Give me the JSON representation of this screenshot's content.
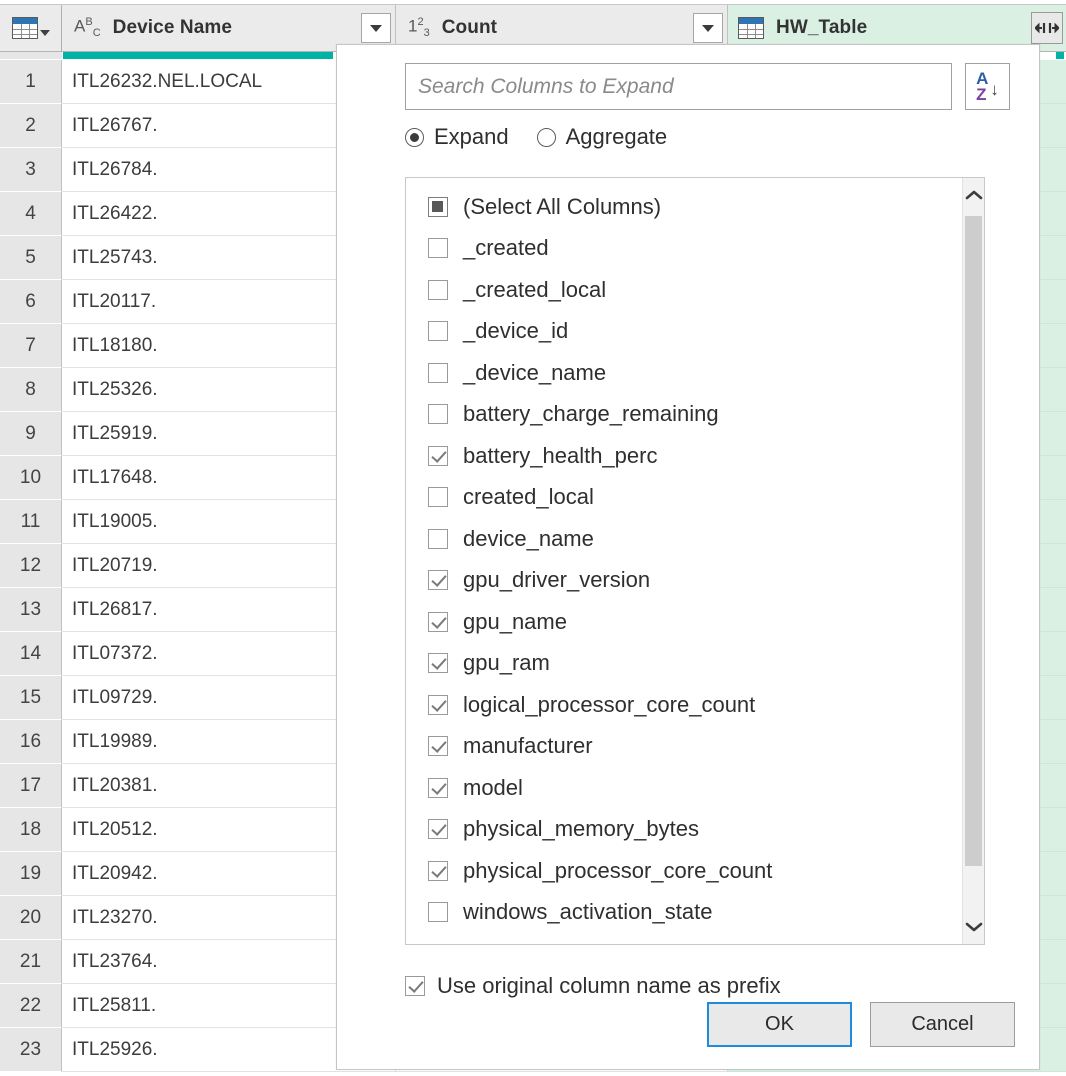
{
  "grid": {
    "corner": {
      "icon": "table-icon",
      "caret": "▾"
    },
    "columns": [
      {
        "id": "device_name",
        "type_icon": "ABC",
        "title": "Device Name",
        "has_filter": true
      },
      {
        "id": "count",
        "type_icon": "123",
        "title": "Count",
        "has_filter": true
      },
      {
        "id": "hw_table",
        "type_icon": "table-icon",
        "title": "HW_Table",
        "has_expand": true,
        "selected": true
      }
    ],
    "rows": [
      {
        "num": "1",
        "device": "ITL26232.NEL.LOCAL"
      },
      {
        "num": "2",
        "device": "ITL26767."
      },
      {
        "num": "3",
        "device": "ITL26784."
      },
      {
        "num": "4",
        "device": "ITL26422."
      },
      {
        "num": "5",
        "device": "ITL25743."
      },
      {
        "num": "6",
        "device": "ITL20117."
      },
      {
        "num": "7",
        "device": "ITL18180."
      },
      {
        "num": "8",
        "device": "ITL25326."
      },
      {
        "num": "9",
        "device": "ITL25919."
      },
      {
        "num": "10",
        "device": "ITL17648."
      },
      {
        "num": "11",
        "device": "ITL19005."
      },
      {
        "num": "12",
        "device": "ITL20719."
      },
      {
        "num": "13",
        "device": "ITL26817."
      },
      {
        "num": "14",
        "device": "ITL07372."
      },
      {
        "num": "15",
        "device": "ITL09729."
      },
      {
        "num": "16",
        "device": "ITL19989."
      },
      {
        "num": "17",
        "device": "ITL20381."
      },
      {
        "num": "18",
        "device": "ITL20512."
      },
      {
        "num": "19",
        "device": "ITL20942."
      },
      {
        "num": "20",
        "device": "ITL23270."
      },
      {
        "num": "21",
        "device": "ITL23764."
      },
      {
        "num": "22",
        "device": "ITL25811."
      },
      {
        "num": "23",
        "device": "ITL25926."
      }
    ]
  },
  "dialog": {
    "search": {
      "value": "",
      "placeholder": "Search Columns to Expand"
    },
    "sort_button": {
      "letter_top": "A",
      "letter_bottom": "Z",
      "arrow": "↓"
    },
    "mode": {
      "selected": "Expand",
      "options": [
        {
          "label": "Expand",
          "checked": true
        },
        {
          "label": "Aggregate",
          "checked": false
        }
      ]
    },
    "columns": [
      {
        "label": "(Select All Columns)",
        "state": "indeterminate"
      },
      {
        "label": "_created",
        "state": "unchecked"
      },
      {
        "label": "_created_local",
        "state": "unchecked"
      },
      {
        "label": "_device_id",
        "state": "unchecked"
      },
      {
        "label": "_device_name",
        "state": "unchecked"
      },
      {
        "label": "battery_charge_remaining",
        "state": "unchecked"
      },
      {
        "label": "battery_health_perc",
        "state": "checked"
      },
      {
        "label": "created_local",
        "state": "unchecked"
      },
      {
        "label": "device_name",
        "state": "unchecked"
      },
      {
        "label": "gpu_driver_version",
        "state": "checked"
      },
      {
        "label": "gpu_name",
        "state": "checked"
      },
      {
        "label": "gpu_ram",
        "state": "checked"
      },
      {
        "label": "logical_processor_core_count",
        "state": "checked"
      },
      {
        "label": "manufacturer",
        "state": "checked"
      },
      {
        "label": "model",
        "state": "checked"
      },
      {
        "label": "physical_memory_bytes",
        "state": "checked"
      },
      {
        "label": "physical_processor_core_count",
        "state": "checked"
      },
      {
        "label": "windows_activation_state",
        "state": "unchecked"
      }
    ],
    "scrollbar": {
      "up": "⌃",
      "down": "⌄"
    },
    "prefix": {
      "label": "Use original column name as prefix",
      "state": "checked"
    },
    "buttons": {
      "ok": "OK",
      "cancel": "Cancel"
    }
  },
  "colors": {
    "selected_column": "#d9f0e3",
    "quality_bar": "#00b3a4",
    "focus_border": "#1e8bdc",
    "table_icon_header": "#2e75b6"
  }
}
